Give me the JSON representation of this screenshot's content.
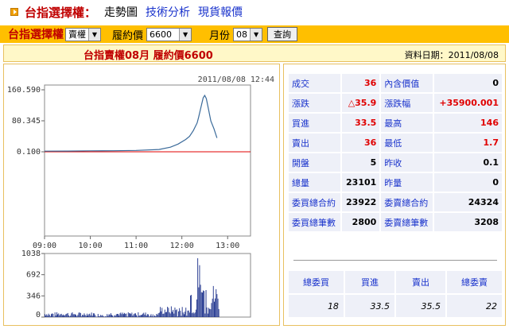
{
  "nav": {
    "title": "台指選擇權：",
    "links": [
      "走勢圖",
      "技術分析",
      "現貨報價"
    ]
  },
  "toolbar": {
    "title": "台指選擇權",
    "type_select": "賣權",
    "strike_label": "履約價",
    "strike_select": "6600",
    "month_label": "月份",
    "month_select": "08",
    "query_button": "查詢"
  },
  "subbar": {
    "title": "台指賣權08月 履約價6600",
    "date": "資料日期：2011/08/08"
  },
  "chart_data": [
    {
      "type": "line",
      "title": "2011/08/08 12:44",
      "y_ticks": [
        "160.590",
        "80.345",
        "0.100"
      ],
      "x_ticks": [
        "09:00",
        "10:00",
        "11:00",
        "12:00",
        "13:00"
      ],
      "reference_line": 0.1,
      "ylim": [
        0.1,
        160.59
      ],
      "x": [
        0,
        30,
        60,
        90,
        120,
        150,
        165,
        175,
        185,
        190,
        195,
        200,
        202,
        205,
        208,
        210,
        212,
        215,
        218,
        222,
        226
      ],
      "values": [
        1.7,
        2.0,
        2.5,
        2.8,
        3.5,
        6,
        12,
        20,
        32,
        40,
        55,
        75,
        90,
        115,
        140,
        146,
        138,
        110,
        80,
        60,
        36
      ],
      "colors": {
        "line": "#3a6a9a",
        "reference": "#e00000"
      }
    },
    {
      "type": "bar",
      "y_ticks": [
        "1038",
        "692",
        "346",
        "0"
      ],
      "ylim": [
        0,
        1038
      ],
      "color": "#1a2f8a"
    }
  ],
  "quotes": {
    "rows": [
      [
        {
          "label": "成交",
          "value": "36",
          "red": true
        },
        {
          "label": "內含價值",
          "value": "0",
          "red": false
        }
      ],
      [
        {
          "label": "漲跌",
          "value": "△35.9",
          "red": true
        },
        {
          "label": "漲跌幅",
          "value": "+35900.001",
          "red": true
        }
      ],
      [
        {
          "label": "買進",
          "value": "33.5",
          "red": true
        },
        {
          "label": "最高",
          "value": "146",
          "red": true
        }
      ],
      [
        {
          "label": "賣出",
          "value": "36",
          "red": true
        },
        {
          "label": "最低",
          "value": "1.7",
          "red": true
        }
      ],
      [
        {
          "label": "開盤",
          "value": "5",
          "red": false
        },
        {
          "label": "昨收",
          "value": "0.1",
          "red": false
        }
      ],
      [
        {
          "label": "總量",
          "value": "23101",
          "red": false
        },
        {
          "label": "昨量",
          "value": "0",
          "red": false
        }
      ],
      [
        {
          "label": "委買總合約",
          "value": "23922",
          "red": false
        },
        {
          "label": "委賣總合約",
          "value": "24324",
          "red": false
        }
      ],
      [
        {
          "label": "委買總筆數",
          "value": "2800",
          "red": false
        },
        {
          "label": "委賣總筆數",
          "value": "3208",
          "red": false
        }
      ]
    ]
  },
  "book": {
    "headers": [
      "總委買",
      "買進",
      "賣出",
      "總委賣"
    ],
    "values": [
      "18",
      "33.5",
      "35.5",
      "22"
    ]
  }
}
